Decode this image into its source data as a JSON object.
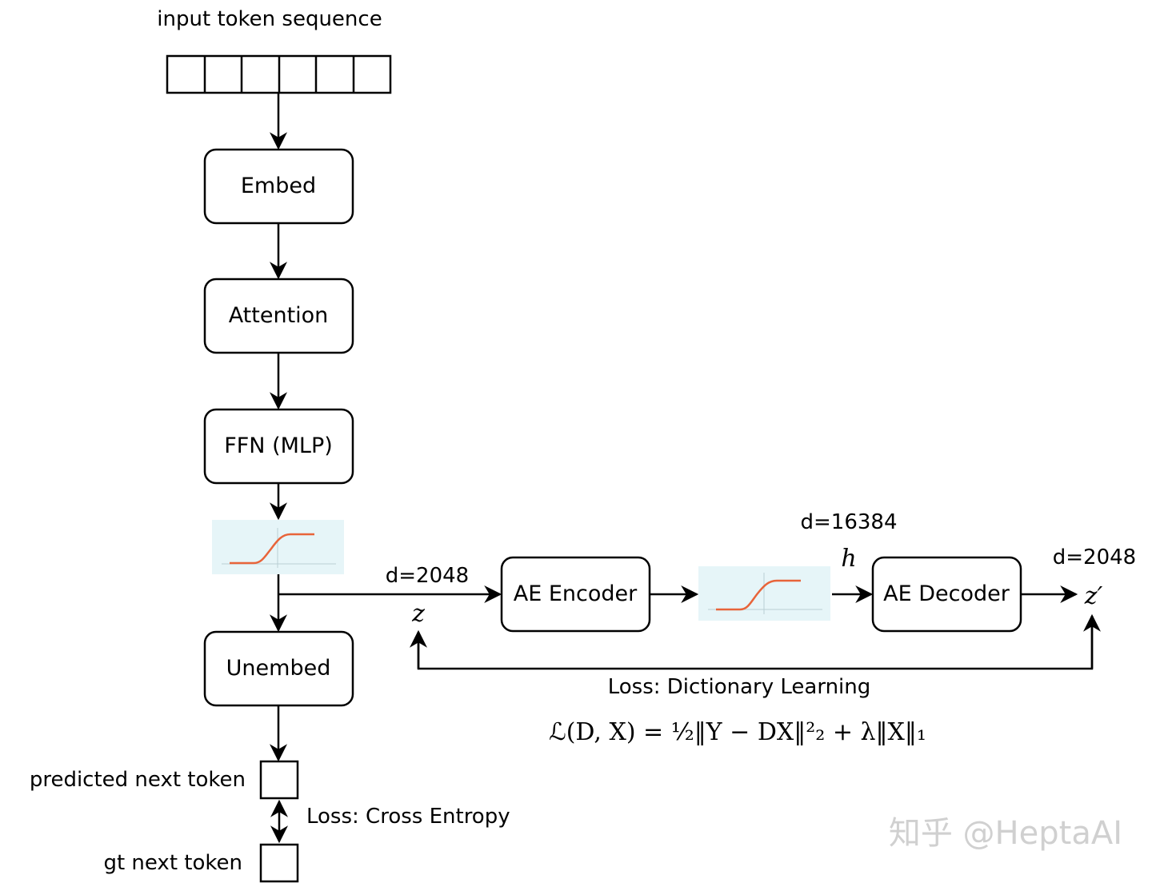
{
  "title": "input token sequence",
  "input_sequence": {
    "cells": 6
  },
  "blocks": {
    "embed": "Embed",
    "attention": "Attention",
    "ffn": "FFN (MLP)",
    "unembed": "Unembed",
    "ae_encoder": "AE Encoder",
    "ae_decoder": "AE Decoder"
  },
  "activation_icon": "sigmoid-activation-plot",
  "dims": {
    "z_dim": "d=2048",
    "h_dim": "d=16384",
    "z_prime_dim": "d=2048"
  },
  "vars": {
    "z": "z",
    "h": "h",
    "z_prime": "z′"
  },
  "losses": {
    "dictionary_title": "Loss: Dictionary Learning",
    "dictionary_formula": "ℒ(D, X) = ½‖Y − DX‖²₂ + λ‖X‖₁",
    "cross_entropy": "Loss: Cross Entropy"
  },
  "tokens": {
    "predicted": "predicted next token",
    "gt": "gt next token"
  },
  "watermark": "知乎 @HeptaAI",
  "colors": {
    "curve": "#e8643a",
    "plot_bg": "#e6f5f8"
  }
}
